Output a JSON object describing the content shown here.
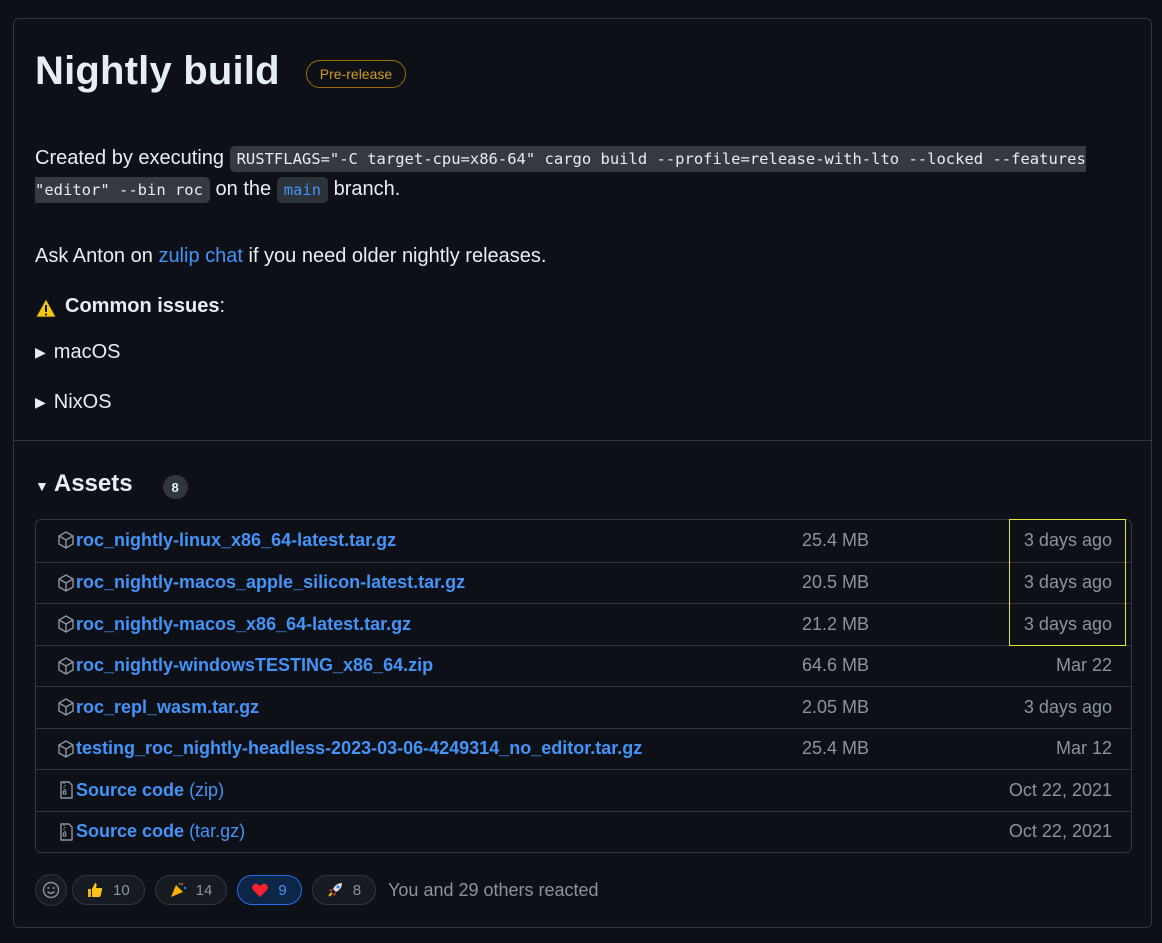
{
  "release": {
    "title": "Nightly build",
    "badge": "Pre-release"
  },
  "description": {
    "p1_prefix": "Created by executing",
    "command": "RUSTFLAGS=\"-C target-cpu=x86-64\" cargo build --profile=release-with-lto --locked --features \"editor\" --bin roc",
    "p1_mid": "on the",
    "branch": "main",
    "p1_suffix": "branch.",
    "p2_prefix": "Ask Anton on",
    "p2_link": "zulip chat",
    "p2_suffix": "if you need older nightly releases.",
    "common_issues": "Common issues",
    "colon": ":",
    "details": [
      "macOS",
      "NixOS"
    ]
  },
  "assets": {
    "heading": "Assets",
    "count": "8",
    "items": [
      {
        "name": "roc_nightly-linux_x86_64-latest.tar.gz",
        "size": "25.4 MB",
        "date": "3 days ago",
        "icon": "package-icon"
      },
      {
        "name": "roc_nightly-macos_apple_silicon-latest.tar.gz",
        "size": "20.5 MB",
        "date": "3 days ago",
        "icon": "package-icon"
      },
      {
        "name": "roc_nightly-macos_x86_64-latest.tar.gz",
        "size": "21.2 MB",
        "date": "3 days ago",
        "icon": "package-icon"
      },
      {
        "name": "roc_nightly-windowsTESTING_x86_64.zip",
        "size": "64.6 MB",
        "date": "Mar 22",
        "icon": "package-icon"
      },
      {
        "name": "roc_repl_wasm.tar.gz",
        "size": "2.05 MB",
        "date": "3 days ago",
        "icon": "package-icon"
      },
      {
        "name": "testing_roc_nightly-headless-2023-03-06-4249314_no_editor.tar.gz",
        "size": "25.4 MB",
        "date": "Mar 12",
        "icon": "package-icon"
      },
      {
        "name": "Source code",
        "suffix": "(zip)",
        "size": "",
        "date": "Oct 22, 2021",
        "icon": "file-zip-icon"
      },
      {
        "name": "Source code",
        "suffix": "(tar.gz)",
        "size": "",
        "date": "Oct 22, 2021",
        "icon": "file-zip-icon"
      }
    ]
  },
  "reactions": {
    "items": [
      {
        "emoji": "thumbs-up",
        "count": "10",
        "active": false
      },
      {
        "emoji": "party-popper",
        "count": "14",
        "active": false
      },
      {
        "emoji": "heart",
        "count": "9",
        "active": true
      },
      {
        "emoji": "rocket",
        "count": "8",
        "active": false
      }
    ],
    "summary": "You and 29 others reacted"
  },
  "colors": {
    "background": "#0d1117",
    "link": "#4493f8",
    "badge": "#d29922",
    "border": "#30363d",
    "highlight": "#e3e33a"
  }
}
